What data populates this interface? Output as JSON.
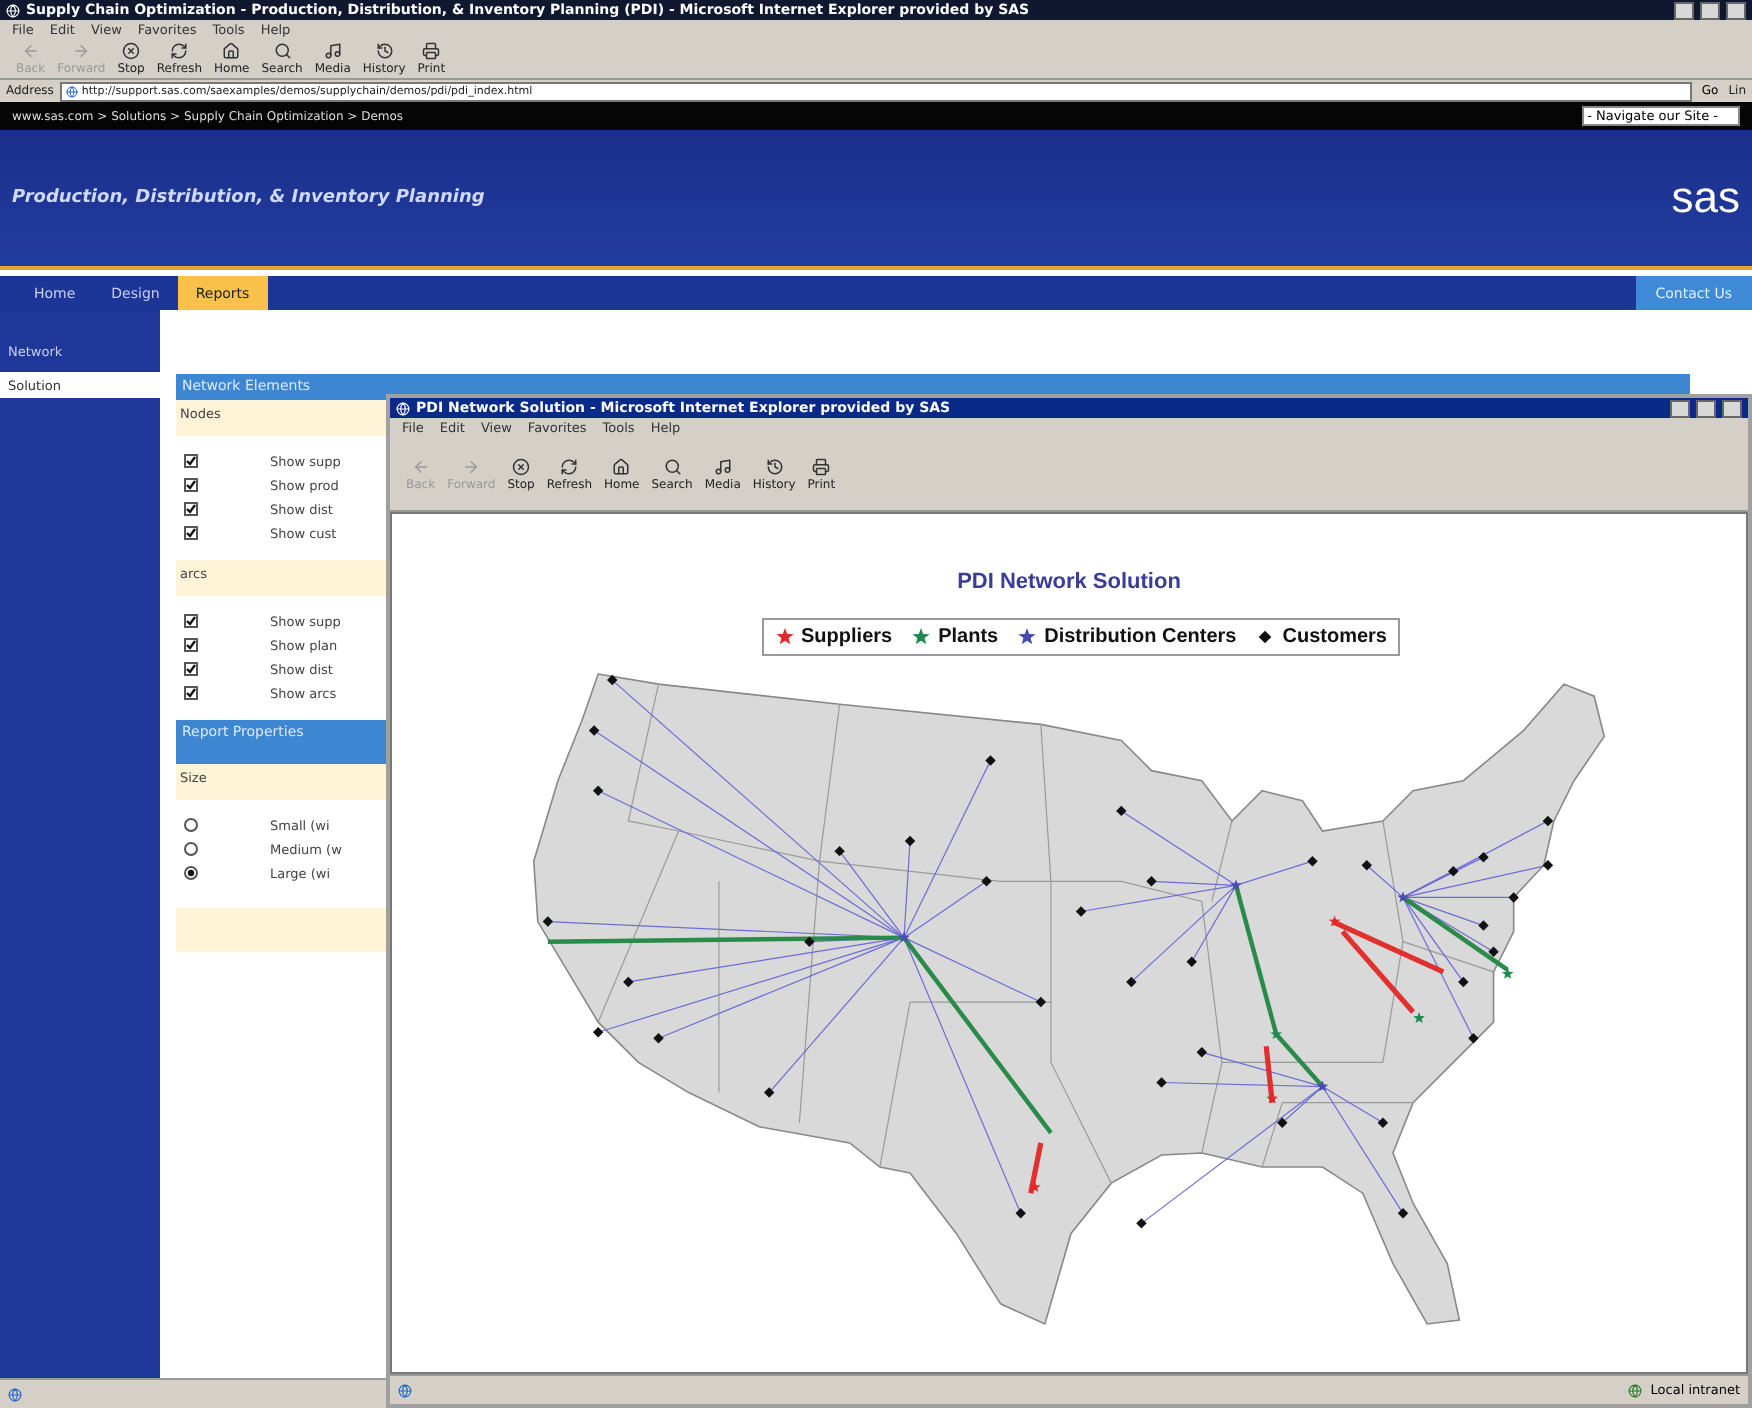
{
  "window": {
    "title": "Supply Chain Optimization - Production, Distribution, & Inventory Planning (PDI) - Microsoft Internet Explorer provided by SAS"
  },
  "menu": [
    "File",
    "Edit",
    "View",
    "Favorites",
    "Tools",
    "Help"
  ],
  "toolbar": [
    {
      "kind": "back",
      "label": "Back",
      "disabled": true
    },
    {
      "kind": "forward",
      "label": "Forward",
      "disabled": true
    },
    {
      "kind": "stop",
      "label": "Stop",
      "disabled": false
    },
    {
      "kind": "refresh",
      "label": "Refresh",
      "disabled": false
    },
    {
      "kind": "home",
      "label": "Home",
      "disabled": false
    },
    {
      "kind": "search",
      "label": "Search",
      "disabled": false
    },
    {
      "kind": "media",
      "label": "Media",
      "disabled": false
    },
    {
      "kind": "history",
      "label": "History",
      "disabled": false
    },
    {
      "kind": "print",
      "label": "Print",
      "disabled": false
    }
  ],
  "address": {
    "label": "Address",
    "value": "http://support.sas.com/saexamples/demos/supplychain/demos/pdi/pdi_index.html",
    "go": "Go",
    "links": "Lin"
  },
  "breadcrumb": "www.sas.com > Solutions > Supply Chain Optimization > Demos",
  "site_nav": "- Navigate our Site -",
  "banner": {
    "title": "Production, Distribution, & Inventory Planning",
    "logo": "sas"
  },
  "tabs": [
    {
      "label": "Home",
      "selected": false
    },
    {
      "label": "Design",
      "selected": false
    },
    {
      "label": "Reports",
      "selected": true
    }
  ],
  "contact": "Contact Us",
  "sidebar": [
    {
      "label": "Network",
      "selected": false
    },
    {
      "label": "Solution",
      "selected": true
    }
  ],
  "sections": [
    {
      "title": "Network Elements",
      "groups": [
        {
          "heading": "Nodes",
          "options": [
            {
              "kind": "checkbox",
              "checked": true,
              "label": "Show supp"
            },
            {
              "kind": "checkbox",
              "checked": true,
              "label": "Show prod"
            },
            {
              "kind": "checkbox",
              "checked": true,
              "label": "Show dist"
            },
            {
              "kind": "checkbox",
              "checked": true,
              "label": "Show cust"
            }
          ]
        },
        {
          "heading": "arcs",
          "options": [
            {
              "kind": "checkbox",
              "checked": true,
              "label": "Show supp"
            },
            {
              "kind": "checkbox",
              "checked": true,
              "label": "Show plan"
            },
            {
              "kind": "checkbox",
              "checked": true,
              "label": "Show dist"
            },
            {
              "kind": "checkbox",
              "checked": true,
              "label": "Show arcs"
            }
          ]
        }
      ]
    },
    {
      "title": "Report Properties",
      "groups": [
        {
          "heading": "Size",
          "options": [
            {
              "kind": "radio",
              "checked": false,
              "label": "Small (wi"
            },
            {
              "kind": "radio",
              "checked": false,
              "label": "Medium (w"
            },
            {
              "kind": "radio",
              "checked": true,
              "label": "Large (wi"
            }
          ]
        }
      ]
    }
  ],
  "popup": {
    "title": "PDI Network Solution - Microsoft Internet Explorer provided by SAS",
    "menu": [
      "File",
      "Edit",
      "View",
      "Favorites",
      "Tools",
      "Help"
    ],
    "toolbar": [
      {
        "kind": "back",
        "label": "Back",
        "disabled": true
      },
      {
        "kind": "forward",
        "label": "Forward",
        "disabled": true
      },
      {
        "kind": "stop",
        "label": "Stop",
        "disabled": false
      },
      {
        "kind": "refresh",
        "label": "Refresh",
        "disabled": false
      },
      {
        "kind": "home",
        "label": "Home",
        "disabled": false
      },
      {
        "kind": "search",
        "label": "Search",
        "disabled": false
      },
      {
        "kind": "media",
        "label": "Media",
        "disabled": false
      },
      {
        "kind": "history",
        "label": "History",
        "disabled": false
      },
      {
        "kind": "print",
        "label": "Print",
        "disabled": false
      }
    ],
    "heading": "PDI Network Solution",
    "legend": [
      {
        "kind": "star",
        "label": "Suppliers",
        "color": "#e02828"
      },
      {
        "kind": "star",
        "label": "Plants",
        "color": "#1e8a50"
      },
      {
        "kind": "star",
        "label": "Distribution Centers",
        "color": "#4a4ab0"
      },
      {
        "kind": "diamond",
        "label": "Customers",
        "color": "#111111"
      }
    ],
    "status": "Local intranet"
  }
}
